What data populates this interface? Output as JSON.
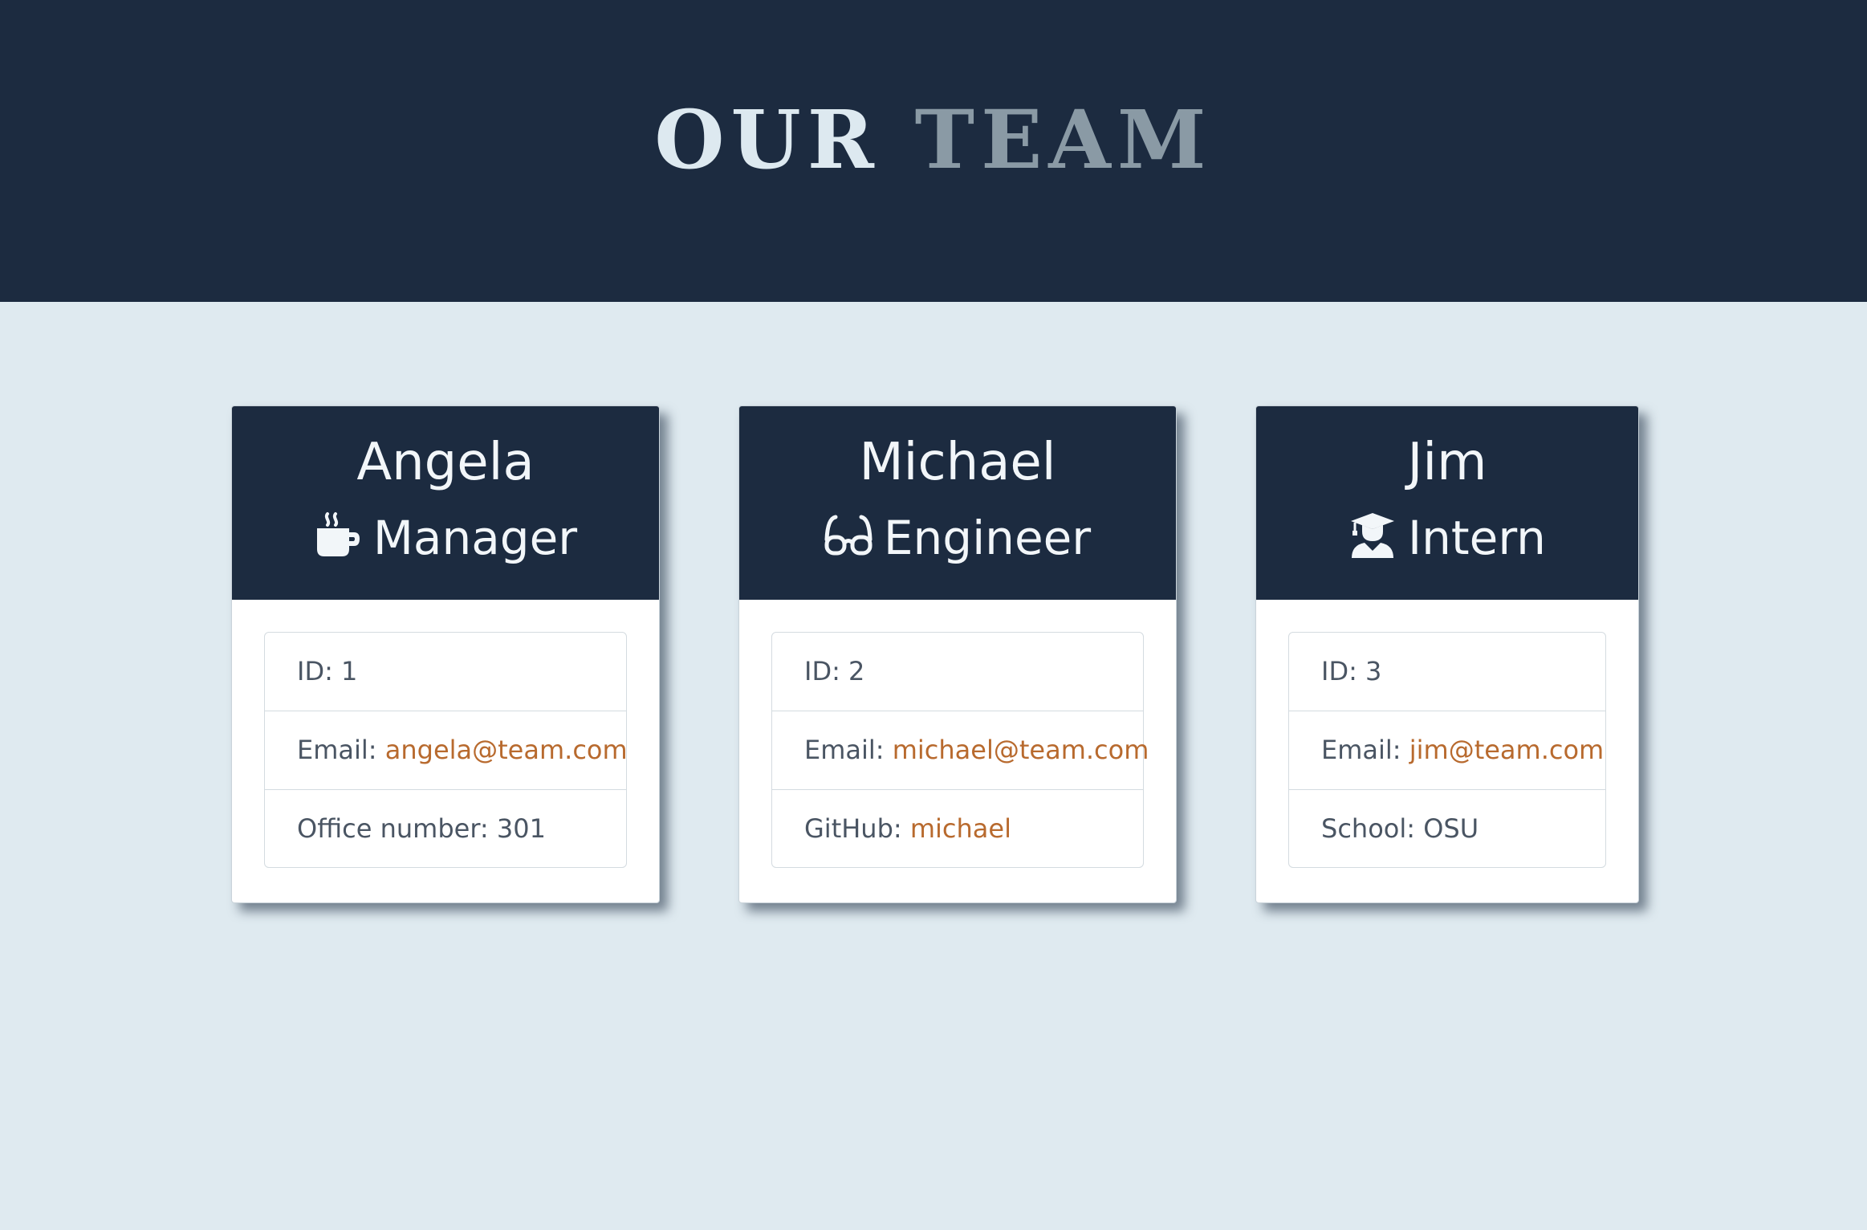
{
  "header": {
    "title_part1": "OUR",
    "title_part2": "TEAM"
  },
  "colors": {
    "header_bg": "#1c2b40",
    "page_bg": "#dfeaf0",
    "link": "#b86a2e",
    "title_accent": "#8a9aa5"
  },
  "employees": [
    {
      "name": "Angela",
      "role": "Manager",
      "role_icon": "coffee-mug-icon",
      "id_label": "ID: ",
      "id": "1",
      "email_label": "Email: ",
      "email": "angela@team.com",
      "extra_label": "Office number: ",
      "extra_value": "301"
    },
    {
      "name": "Michael",
      "role": "Engineer",
      "role_icon": "glasses-icon",
      "id_label": "ID: ",
      "id": "2",
      "email_label": "Email: ",
      "email": "michael@team.com",
      "extra_label": "GitHub: ",
      "extra_value": "michael"
    },
    {
      "name": "Jim",
      "role": "Intern",
      "role_icon": "graduate-icon",
      "id_label": "ID: ",
      "id": "3",
      "email_label": "Email: ",
      "email": "jim@team.com",
      "extra_label": "School: ",
      "extra_value": "OSU"
    }
  ]
}
